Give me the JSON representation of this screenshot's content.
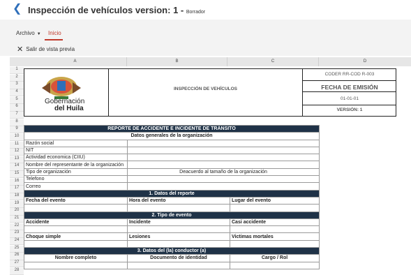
{
  "header": {
    "title": "Inspección de vehículos version: 1 -",
    "status": "Borrador"
  },
  "ribbon": {
    "file_label": "Archivo",
    "home_label": "Inicio",
    "exit_preview": "Salir de vista previa"
  },
  "sheet": {
    "columns": [
      "A",
      "B",
      "C",
      "D"
    ],
    "rows": [
      "1",
      "2",
      "3",
      "4",
      "5",
      "6",
      "7",
      "8",
      "9",
      "10",
      "11",
      "12",
      "13",
      "14",
      "15",
      "16",
      "17",
      "18",
      "19",
      "20",
      "21",
      "22",
      "23",
      "24",
      "25",
      "26",
      "27",
      "28"
    ],
    "logo_line1": "Gobernación",
    "logo_line2": "del Huila",
    "doc_title": "INSPECCIÓN DE VEHÍCULOS",
    "code": "CODER RR-COD R-003",
    "date_label": "FECHA DE EMISIÓN",
    "date_value": "01-01-01",
    "version_label": "VERSIÓN:   1",
    "report_title": "REPORTE DE ACCIDENTE E INCIDENTE DE TRÁNSITO",
    "general_title": "Datos generales de la organización",
    "general_fields": [
      "Razón social",
      "NIT",
      "Actividad economica (CIIU)",
      "Nombre del representante de la organización",
      "Tipo de organización",
      "Telefono",
      "Correo"
    ],
    "org_type_value": "Deacuerdo al tamaño de la organización",
    "section1": "1. Datos del reporte",
    "s1_cols": [
      "Fecha del evento",
      "Hora del evento",
      "Lugar del evento"
    ],
    "section2": "2. Tipo de evento",
    "s2_row1": [
      "Accidente",
      "Incidente",
      "Casi accidente"
    ],
    "s2_row2": [
      "Choque simple",
      "Lesiones",
      "Victimas mortales"
    ],
    "section3": "3. Datos del (la) conductor (a)",
    "s3_cols": [
      "Nombre completo",
      "Documento de identidad",
      "Cargo / Rol"
    ]
  }
}
